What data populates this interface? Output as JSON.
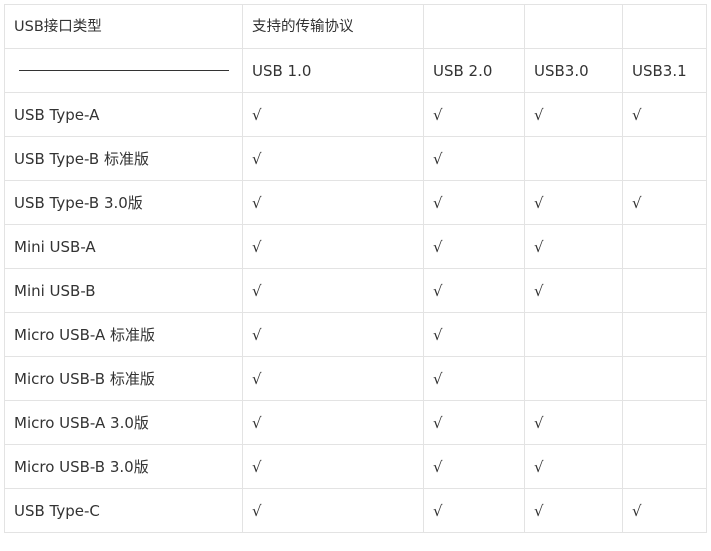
{
  "table": {
    "header": {
      "col0": "USB接口类型",
      "col1": "支持的传输协议",
      "col2": "",
      "col3": "",
      "col4": ""
    },
    "subheader": {
      "protocols": [
        "USB 1.0",
        "USB 2.0",
        "USB3.0",
        "USB3.1"
      ]
    },
    "check_symbol": "√",
    "rows": [
      {
        "type": "USB Type-A",
        "support": [
          "√",
          "√",
          "√",
          "√"
        ]
      },
      {
        "type": "USB Type-B 标准版",
        "support": [
          "√",
          "√",
          "",
          ""
        ]
      },
      {
        "type": "USB Type-B 3.0版",
        "support": [
          "√",
          "√",
          "√",
          "√"
        ]
      },
      {
        "type": "Mini USB-A",
        "support": [
          "√",
          "√",
          "√",
          ""
        ]
      },
      {
        "type": "Mini USB-B",
        "support": [
          "√",
          "√",
          "√",
          ""
        ]
      },
      {
        "type": "Micro USB-A 标准版",
        "support": [
          "√",
          "√",
          "",
          ""
        ]
      },
      {
        "type": "Micro USB-B 标准版",
        "support": [
          "√",
          "√",
          "",
          ""
        ]
      },
      {
        "type": "Micro USB-A 3.0版",
        "support": [
          "√",
          "√",
          "√",
          ""
        ]
      },
      {
        "type": "Micro USB-B 3.0版",
        "support": [
          "√",
          "√",
          "√",
          ""
        ]
      },
      {
        "type": "USB Type-C",
        "support": [
          "√",
          "√",
          "√",
          "√"
        ]
      }
    ]
  }
}
